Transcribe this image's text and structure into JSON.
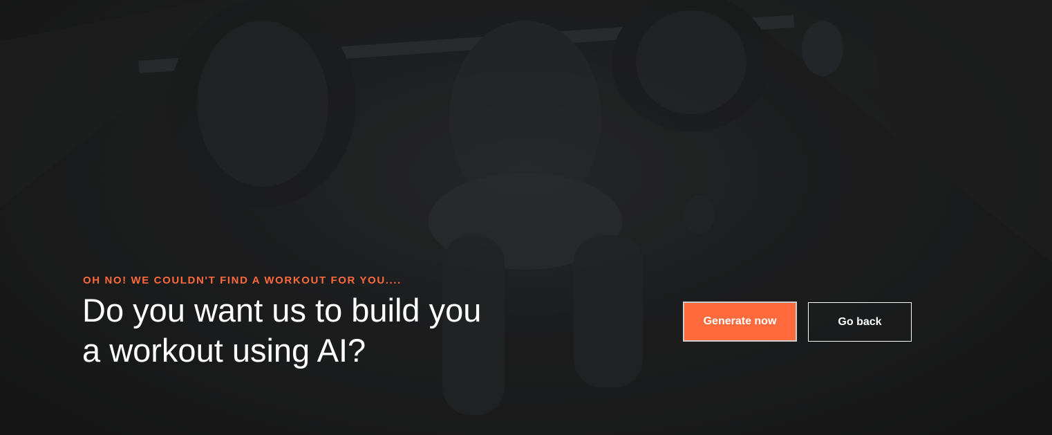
{
  "hero": {
    "notice": "OH NO! WE COULDN'T FIND A WORKOUT FOR YOU....",
    "headline_line1": "Do you want us to build you",
    "headline_line2": "a workout using AI?",
    "accent_color": "#ff6a3d"
  },
  "actions": {
    "generate_label": "Generate now",
    "back_label": "Go back"
  }
}
